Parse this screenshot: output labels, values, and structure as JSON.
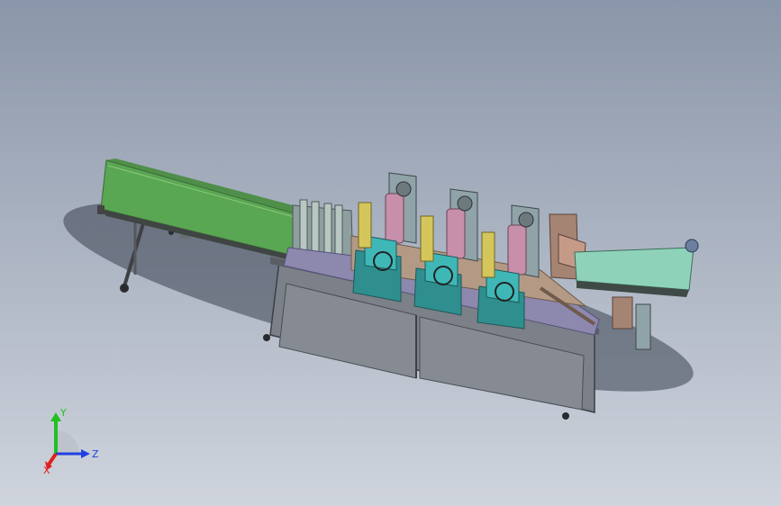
{
  "viewport": {
    "background_top": "#8a96a9",
    "background_bottom": "#cfd4dd"
  },
  "colors": {
    "conveyor_green": "#59a653",
    "conveyor_green_light": "#7fc06f",
    "frame_gray": "#7f838a",
    "frame_dark": "#4a4d52",
    "module_teal": "#2f8f8f",
    "module_teal_light": "#3fb7b7",
    "roller_pink": "#c78faa",
    "table_tan": "#b49a84",
    "outfeed_mint": "#8ed3b9",
    "rail_purple": "#8d88ad"
  },
  "triad": {
    "x_label": "X",
    "y_label": "Y",
    "z_label": "Z",
    "x_color": "#e02020",
    "y_color": "#20c020",
    "z_color": "#2040e0"
  }
}
